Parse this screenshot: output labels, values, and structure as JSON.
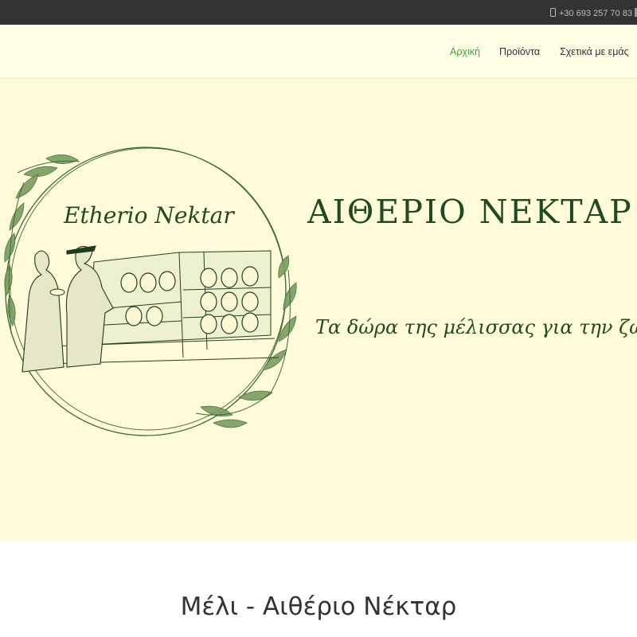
{
  "topbar": {
    "phone": "+30 693 257 70 83"
  },
  "nav": {
    "items": [
      {
        "label": "Αρχική",
        "active": true
      },
      {
        "label": "Προϊόντα",
        "active": false
      },
      {
        "label": "Σχετικά με εμάς",
        "active": false
      }
    ]
  },
  "hero": {
    "logo_text": "Etherio Nektar",
    "title": "ΑΙΘΕΡΙΟ ΝΕΚΤΑΡ",
    "tagline": "Τα δώρα της μέλισσας για την ζωή"
  },
  "main": {
    "section_title": "Μέλι - Αιθέριο Νέκταρ"
  },
  "colors": {
    "topbar_bg": "#333333",
    "header_bg": "#fffee5",
    "hero_bg": "#fffad9",
    "accent_green": "#3fa144",
    "logo_green": "#1f4a24"
  }
}
